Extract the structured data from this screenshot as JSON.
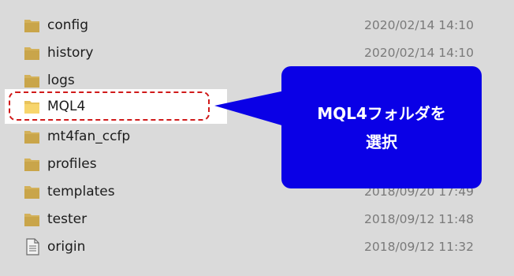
{
  "files": [
    {
      "name": "config",
      "date": "2020/02/14 14:10",
      "type": "folder"
    },
    {
      "name": "history",
      "date": "2020/02/14 14:10",
      "type": "folder"
    },
    {
      "name": "logs",
      "date": "",
      "type": "folder"
    },
    {
      "name": "MQL4",
      "date": "",
      "type": "folder",
      "selected": true
    },
    {
      "name": "mt4fan_ccfp",
      "date": "",
      "type": "folder"
    },
    {
      "name": "profiles",
      "date": "",
      "type": "folder"
    },
    {
      "name": "templates",
      "date": "2018/09/20 17:49",
      "type": "folder"
    },
    {
      "name": "tester",
      "date": "2018/09/12 11:48",
      "type": "folder"
    },
    {
      "name": "origin",
      "date": "2018/09/12 11:32",
      "type": "file"
    }
  ],
  "callout": {
    "line1": "MQL4フォルダを",
    "line2": "選択"
  },
  "colors": {
    "dim_background": "#dadada",
    "folder_dim": "#c9a54a",
    "folder_bright": "#f7d56c",
    "highlight_border": "#d01a1a",
    "callout_fill": "#0a00e6",
    "callout_text": "#ffffff"
  }
}
